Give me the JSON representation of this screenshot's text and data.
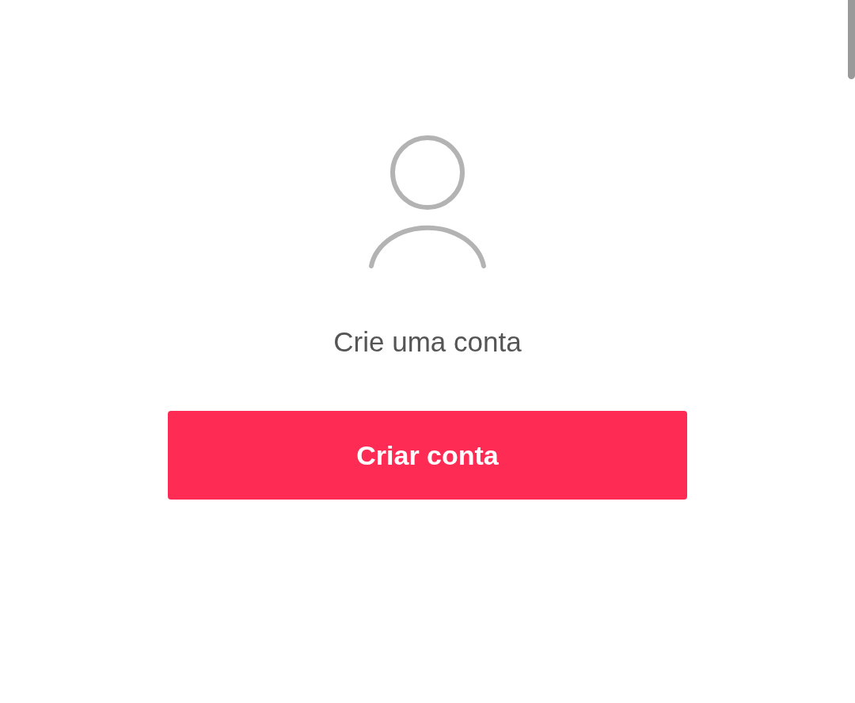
{
  "prompt": {
    "message": "Crie uma conta"
  },
  "button": {
    "label": "Criar conta"
  }
}
